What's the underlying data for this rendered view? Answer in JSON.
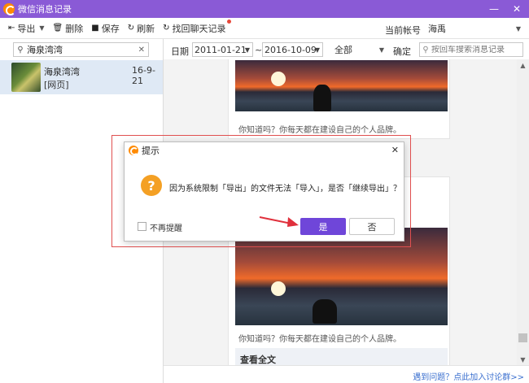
{
  "window": {
    "title": "微信消息记录",
    "minimize_label": "—",
    "close_label": "✕"
  },
  "toolbar": {
    "export_label": "导出",
    "delete_label": "删除",
    "save_label": "保存",
    "refresh_label": "刷新",
    "recover_label": "找回聊天记录",
    "account_label": "当前帐号",
    "account_value": "海禹"
  },
  "sidebar": {
    "search_value": "海泉湾湾",
    "contacts": [
      {
        "name": "海泉湾湾",
        "date": "16-9-21",
        "preview": "[网页]"
      }
    ]
  },
  "filter": {
    "date_label": "日期",
    "date_from": "2011-01-21",
    "date_separator": "~",
    "date_to": "2016-10-09",
    "type_value": "全部",
    "confirm_label": "确定",
    "search_placeholder": "按回车搜索消息记录"
  },
  "messages": [
    {
      "caption": "你知道吗？你每天都在建设自己的个人品牌。"
    },
    {
      "caption": "你知道吗？你每天都在建设自己的个人品牌。",
      "footer": "查看全文"
    }
  ],
  "status": {
    "feedback_link": "遇到问题？点此加入讨论群>>"
  },
  "dialog": {
    "title": "提示",
    "close_label": "✕",
    "warning_glyph": "?",
    "message": "因为系统限制「导出」的文件无法「导入」，是否「继续导出」？",
    "checkbox_label": "不再提醒",
    "yes_label": "是",
    "no_label": "否"
  },
  "colors": {
    "titlebar": "#8a5ad6",
    "primary_button": "#6f46d9",
    "warning": "#f4a024",
    "highlight_outline": "#e05050",
    "annotation_arrow": "#e0303c"
  }
}
